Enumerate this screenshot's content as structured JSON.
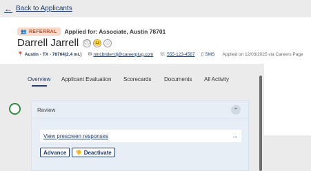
{
  "nav": {
    "back_arrow": "←",
    "back_label": "Back to Applicants"
  },
  "candidate": {
    "badge_label": "REFERRAL",
    "applied_for": "Applied for: Associate, Austin 78701",
    "name": "Darrell Jarrell",
    "faces": [
      "☹",
      "😐",
      "☺"
    ],
    "location": "Austin - TX - 78704(2.4 mi.)",
    "email": "nmcbride+dj@careerplug.com",
    "phone": "555-123-4567",
    "sms_label": "SMS",
    "applied_on": "Applied on 12/03/2025 via Careers Page"
  },
  "tabs": [
    {
      "label": "Overview",
      "active": true
    },
    {
      "label": "Applicant Evaluation",
      "active": false
    },
    {
      "label": "Scorecards",
      "active": false
    },
    {
      "label": "Documents",
      "active": false
    },
    {
      "label": "All Activity",
      "active": false
    }
  ],
  "review": {
    "title": "Review",
    "collapse_icon": "⌃",
    "prescreen_link": "View prescreen responses",
    "prescreen_arrow": "→",
    "advance_label": "Advance",
    "deactivate_label": "Deactivate",
    "deactivate_icon": "👎"
  },
  "colors": {
    "accent": "#1f3a66",
    "badge_bg": "#fbd9c8",
    "badge_text": "#c0502a",
    "timeline_green": "#2f8a43",
    "card_bg": "#e7eef6"
  }
}
